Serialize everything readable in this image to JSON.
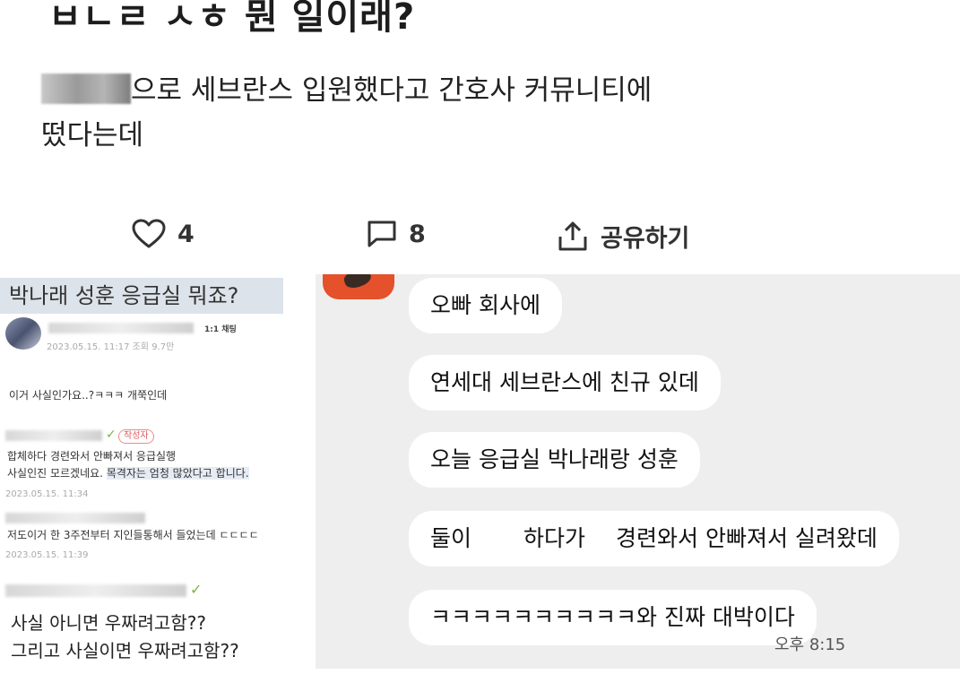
{
  "post": {
    "title": "ㅂㄴㄹ ㅅㅎ 뭔 일이래?",
    "body_line1": "으로 세브란스 입원했다고 간호사 커뮤니티에",
    "body_line2": "떴다는데",
    "like_count": "4",
    "comment_count": "8",
    "share_label": "공유하기"
  },
  "left_panel": {
    "title": "박나래 성훈 응급실 뭐죠?",
    "chat_label": "1:1 채팅",
    "post_meta": "2023.05.15. 11:17  조회 9.7만",
    "post_text": "이거 사실인가요..?ㅋㅋㅋ 개쭉인데",
    "author_badge": "작성자",
    "comment1_line1": "합체하다 경련와서 안빠져서 응급실행",
    "comment1_line2_plain": "사실인진 모르겠네요. ",
    "comment1_line2_highlight": "목격자는 엄청 많았다고 합니다.",
    "comment1_time": "2023.05.15. 11:34",
    "comment2_text": "저도이거 한 3주전부터 지인들통해서 들었는데 ㄷㄷㄷㄷ",
    "comment2_time": "2023.05.15. 11:39",
    "reply_line1": "사실 아니면 우짜려고함??",
    "reply_line2": "그리고 사실이면 우짜려고함??"
  },
  "chat": {
    "messages": [
      "오빠 회사에",
      "연세대 세브란스에 친규 있데",
      "오늘 응급실 박나래랑 성훈",
      "ㅋㅋㅋㅋㅋㅋㅋㅋㅋㅋ와 진짜 대박이다"
    ],
    "msg4_part1": "둘이",
    "msg4_part2": "하다가",
    "msg4_part3": "경련와서 안빠져서 실려왔데",
    "time": "오후 8:15"
  },
  "icons": {
    "like": "heart-icon",
    "comment": "comment-icon",
    "share": "share-icon",
    "sprout": "sprout-icon"
  },
  "colors": {
    "title_bg": "#dde3ea",
    "chat_bg": "#eeeeee",
    "badge_red": "#e05b5b",
    "avatar_orange": "#e5512a"
  }
}
